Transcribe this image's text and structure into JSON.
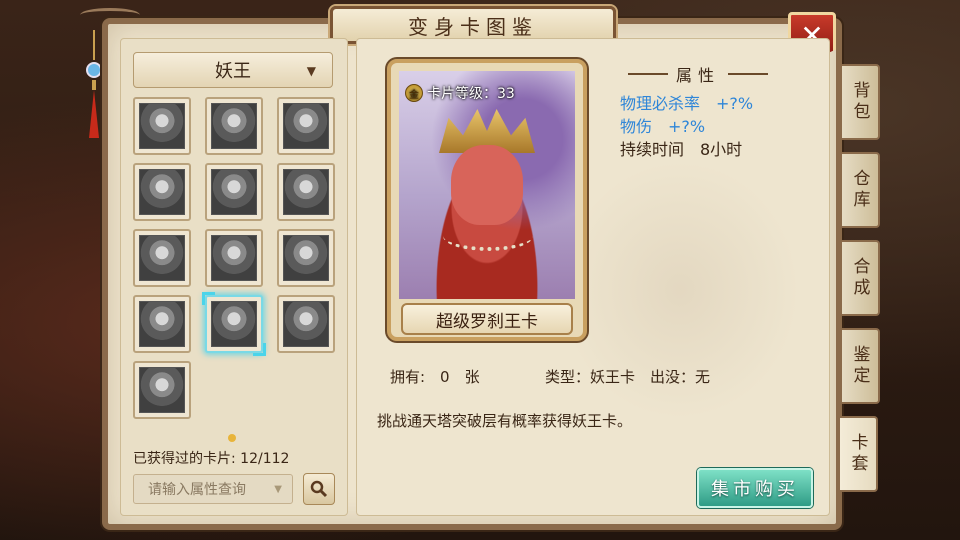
{
  "window": {
    "title": "变身卡图鉴",
    "close_label": "✕"
  },
  "filter": {
    "selected": "妖王",
    "arrow": "▼"
  },
  "cards_grid": {
    "count": 13,
    "selected_index": 10
  },
  "obtained": {
    "label": "已获得过的卡片: 12/112"
  },
  "search": {
    "placeholder": "请输入属性查询",
    "arrow": "▼"
  },
  "card": {
    "level_badge": "金",
    "level_text": "卡片等级：33",
    "name": "超级罗刹王卡"
  },
  "attributes": {
    "header": "属性",
    "lines": [
      {
        "text": "物理必杀率　+?%"
      },
      {
        "text": "物伤　+?%"
      },
      {
        "text": "持续时间　8小时"
      }
    ]
  },
  "info": {
    "own": "拥有:　0　张",
    "type": "类型：妖王卡　出没：无",
    "description": "挑战通天塔突破层有概率获得妖王卡。"
  },
  "buy_button": {
    "label": "集市购买"
  },
  "side_tabs": [
    {
      "label": "背包"
    },
    {
      "label": "仓库"
    },
    {
      "label": "合成"
    },
    {
      "label": "鉴定"
    },
    {
      "label": "卡套"
    }
  ],
  "colors": {
    "accent_blue": "#2f86d8",
    "buy_green": "#2f9c86",
    "close_red": "#c83a2a"
  }
}
